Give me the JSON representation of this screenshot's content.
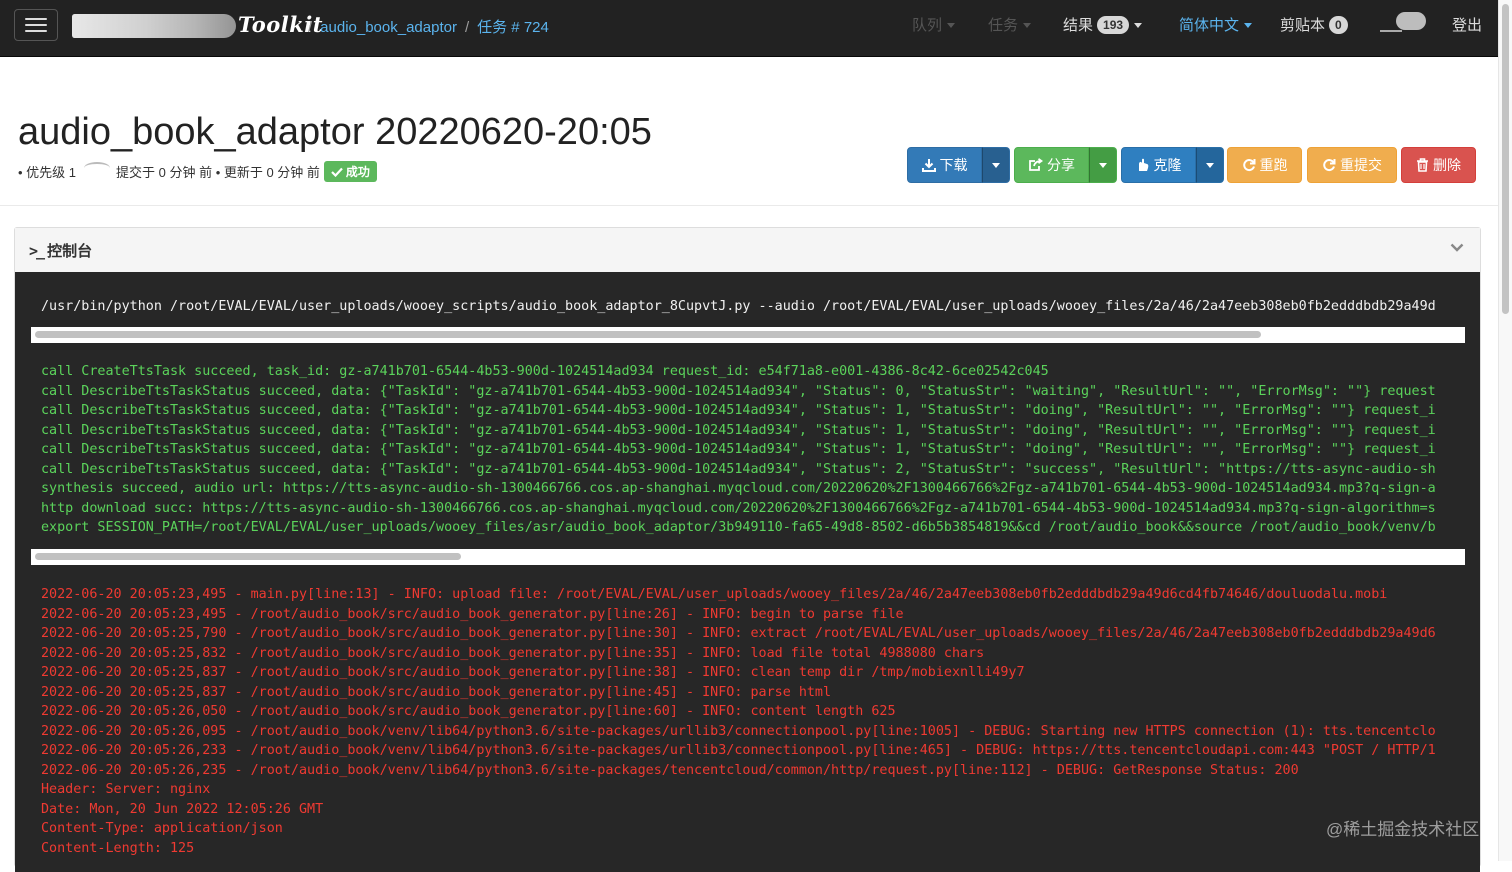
{
  "navbar": {
    "brand": "Toolkit",
    "breadcrumb": {
      "script": "audio_book_adaptor",
      "sep": "/",
      "job": "任务 # 724"
    },
    "queue": "队列",
    "tasks": "任务",
    "results": "结果",
    "results_count": "193",
    "language": "简体中文",
    "clipboard": "剪贴本",
    "clipboard_count": "0",
    "logout": "登出"
  },
  "header": {
    "title": "audio_book_adaptor 20220620-20:05",
    "priority": "• 优先级 1",
    "submitted": "提交于 0 分钟 前 • 更新于 0 分钟 前",
    "status": "成功"
  },
  "actions": {
    "download": "下载",
    "share": "分享",
    "clone": "克隆",
    "rerun": "重跑",
    "resubmit": "重提交",
    "delete": "删除"
  },
  "console": {
    "title": "控制台",
    "command": "/usr/bin/python /root/EVAL/EVAL/user_uploads/wooey_scripts/audio_book_adaptor_8CupvtJ.py --audio /root/EVAL/EVAL/user_uploads/wooey_files/2a/46/2a47eeb308eb0fb2edddbdb29a49d",
    "stdout": [
      "call CreateTtsTask succeed, task_id: gz-a741b701-6544-4b53-900d-1024514ad934 request_id: e54f71a8-e001-4386-8c42-6ce02542c045",
      "call DescribeTtsTaskStatus succeed, data: {\"TaskId\": \"gz-a741b701-6544-4b53-900d-1024514ad934\", \"Status\": 0, \"StatusStr\": \"waiting\", \"ResultUrl\": \"\", \"ErrorMsg\": \"\"} request",
      "call DescribeTtsTaskStatus succeed, data: {\"TaskId\": \"gz-a741b701-6544-4b53-900d-1024514ad934\", \"Status\": 1, \"StatusStr\": \"doing\", \"ResultUrl\": \"\", \"ErrorMsg\": \"\"} request_i",
      "call DescribeTtsTaskStatus succeed, data: {\"TaskId\": \"gz-a741b701-6544-4b53-900d-1024514ad934\", \"Status\": 1, \"StatusStr\": \"doing\", \"ResultUrl\": \"\", \"ErrorMsg\": \"\"} request_i",
      "call DescribeTtsTaskStatus succeed, data: {\"TaskId\": \"gz-a741b701-6544-4b53-900d-1024514ad934\", \"Status\": 1, \"StatusStr\": \"doing\", \"ResultUrl\": \"\", \"ErrorMsg\": \"\"} request_i",
      "call DescribeTtsTaskStatus succeed, data: {\"TaskId\": \"gz-a741b701-6544-4b53-900d-1024514ad934\", \"Status\": 2, \"StatusStr\": \"success\", \"ResultUrl\": \"https://tts-async-audio-sh",
      "synthesis succeed, audio url: https://tts-async-audio-sh-1300466766.cos.ap-shanghai.myqcloud.com/20220620%2F1300466766%2Fgz-a741b701-6544-4b53-900d-1024514ad934.mp3?q-sign-a",
      "http download succ: https://tts-async-audio-sh-1300466766.cos.ap-shanghai.myqcloud.com/20220620%2F1300466766%2Fgz-a741b701-6544-4b53-900d-1024514ad934.mp3?q-sign-algorithm=s",
      "export SESSION_PATH=/root/EVAL/EVAL/user_uploads/wooey_files/asr/audio_book_adaptor/3b949110-fa65-49d8-8502-d6b5b3854819&&cd /root/audio_book&&source /root/audio_book/venv/b"
    ],
    "stderr": [
      "2022-06-20 20:05:23,495 - main.py[line:13] - INFO: upload file: /root/EVAL/EVAL/user_uploads/wooey_files/2a/46/2a47eeb308eb0fb2edddbdb29a49d6cd4fb74646/douluodalu.mobi",
      "2022-06-20 20:05:23,495 - /root/audio_book/src/audio_book_generator.py[line:26] - INFO: begin to parse file",
      "2022-06-20 20:05:25,790 - /root/audio_book/src/audio_book_generator.py[line:30] - INFO: extract /root/EVAL/EVAL/user_uploads/wooey_files/2a/46/2a47eeb308eb0fb2edddbdb29a49d6",
      "2022-06-20 20:05:25,832 - /root/audio_book/src/audio_book_generator.py[line:35] - INFO: load file total 4988080 chars",
      "2022-06-20 20:05:25,837 - /root/audio_book/src/audio_book_generator.py[line:38] - INFO: clean temp dir /tmp/mobiexnlli49y7",
      "2022-06-20 20:05:25,837 - /root/audio_book/src/audio_book_generator.py[line:45] - INFO: parse html",
      "2022-06-20 20:05:26,050 - /root/audio_book/src/audio_book_generator.py[line:60] - INFO: content length 625",
      "2022-06-20 20:05:26,095 - /root/audio_book/venv/lib64/python3.6/site-packages/urllib3/connectionpool.py[line:1005] - DEBUG: Starting new HTTPS connection (1): tts.tencentclo",
      "2022-06-20 20:05:26,233 - /root/audio_book/venv/lib64/python3.6/site-packages/urllib3/connectionpool.py[line:465] - DEBUG: https://tts.tencentcloudapi.com:443 \"POST / HTTP/1",
      "2022-06-20 20:05:26,235 - /root/audio_book/venv/lib64/python3.6/site-packages/tencentcloud/common/http/request.py[line:112] - DEBUG: GetResponse Status: 200",
      "Header: Server: nginx",
      "Date: Mon, 20 Jun 2022 12:05:26 GMT",
      "Content-Type: application/json",
      "Content-Length: 125"
    ]
  },
  "watermark": "@稀土掘金技术社区",
  "colors": {
    "navbar_bg": "#222222",
    "link": "#5bb4ee",
    "console_bg": "#272727",
    "stdout": "#5bd35b",
    "stderr": "#ef3a32",
    "primary": "#337ab7",
    "success": "#5cb85c",
    "warning": "#f0ad4e",
    "danger": "#d9534f"
  },
  "icons": {
    "menu": "hamburger-icon",
    "download": "download-icon",
    "share": "share-icon",
    "clone": "clone-icon",
    "rerun": "refresh-icon",
    "resubmit": "refresh-icon",
    "delete": "trash-icon",
    "status": "check-icon",
    "console": "terminal-icon",
    "collapse": "chevron-down-icon"
  }
}
